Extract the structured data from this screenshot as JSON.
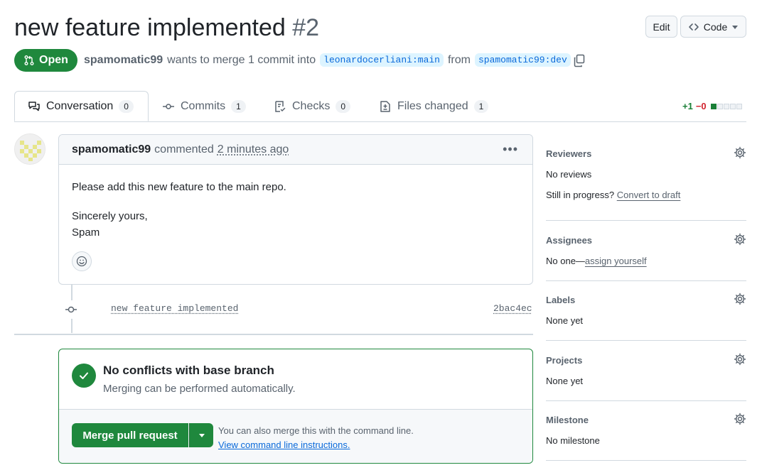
{
  "pr": {
    "title": "new feature implemented",
    "number": "#2",
    "state": "Open",
    "author": "spamomatic99",
    "merge_text": "wants to merge 1 commit into",
    "base_branch": "leonardocerliani:main",
    "from_text": "from",
    "head_branch": "spamomatic99:dev"
  },
  "header": {
    "edit_label": "Edit",
    "code_label": "Code"
  },
  "tabs": [
    {
      "label": "Conversation",
      "count": "0"
    },
    {
      "label": "Commits",
      "count": "1"
    },
    {
      "label": "Checks",
      "count": "0"
    },
    {
      "label": "Files changed",
      "count": "1"
    }
  ],
  "diffstat": {
    "additions": "+1",
    "deletions": "−0"
  },
  "comment": {
    "author": "spamomatic99",
    "action": "commented",
    "time": "2 minutes ago",
    "body_line1": "Please add this new feature to the main repo.",
    "body_line2": "Sincerely yours,",
    "body_line3": "Spam"
  },
  "commit": {
    "message": "new feature implemented",
    "sha": "2bac4ec"
  },
  "merge": {
    "title": "No conflicts with base branch",
    "subtitle": "Merging can be performed automatically.",
    "button_label": "Merge pull request",
    "hint": "You can also merge this with the command line.",
    "hint_link": "View command line instructions."
  },
  "sidebar": {
    "reviewers": {
      "title": "Reviewers",
      "value": "No reviews",
      "progress_text": "Still in progress?",
      "progress_link": "Convert to draft"
    },
    "assignees": {
      "title": "Assignees",
      "value_prefix": "No one—",
      "value_link": "assign yourself"
    },
    "labels": {
      "title": "Labels",
      "value": "None yet"
    },
    "projects": {
      "title": "Projects",
      "value": "None yet"
    },
    "milestone": {
      "title": "Milestone",
      "value": "No milestone"
    }
  },
  "colors": {
    "accent_green": "#1f883d",
    "link_blue": "#0969da",
    "muted": "#59636e"
  }
}
